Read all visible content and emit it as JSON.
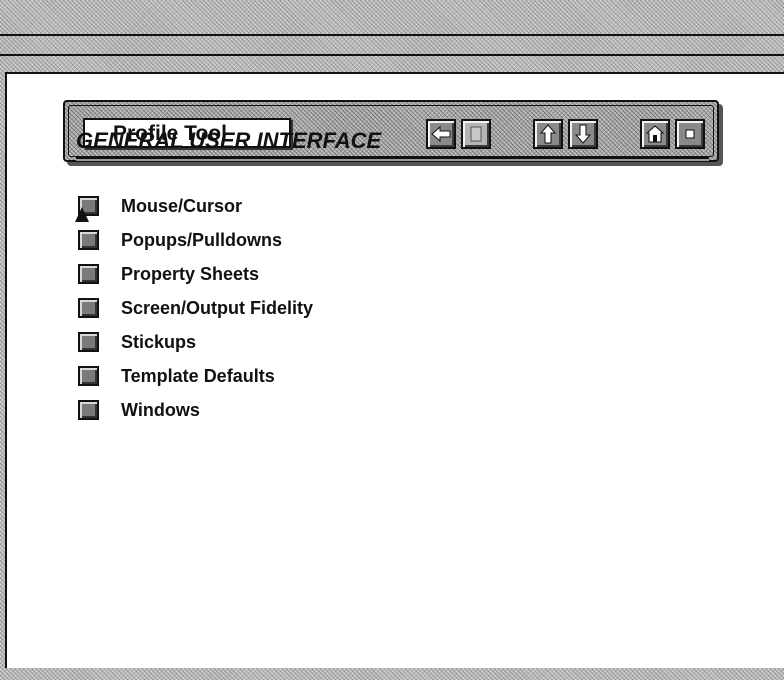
{
  "toolbar": {
    "title": "Profile Tool",
    "buttons": [
      {
        "icon": "left-arrow-icon",
        "enabled": true
      },
      {
        "icon": "blank-page-icon",
        "enabled": false
      },
      {
        "icon": "up-arrow-icon",
        "enabled": true
      },
      {
        "icon": "down-arrow-icon",
        "enabled": true
      },
      {
        "icon": "home-icon",
        "enabled": true
      },
      {
        "icon": "stop-icon",
        "enabled": true
      }
    ]
  },
  "section": {
    "heading": "GENERAL USER INTERFACE"
  },
  "menu": {
    "items": [
      {
        "label": "Mouse/Cursor"
      },
      {
        "label": "Popups/Pulldowns"
      },
      {
        "label": "Property Sheets"
      },
      {
        "label": "Screen/Output Fidelity"
      },
      {
        "label": "Stickups"
      },
      {
        "label": "Template Defaults"
      },
      {
        "label": "Windows"
      }
    ]
  },
  "colors": {
    "frame": "#bdbdbd",
    "content_background": "#ffffff",
    "button_face": "#8a8a8a",
    "text": "#111111"
  }
}
